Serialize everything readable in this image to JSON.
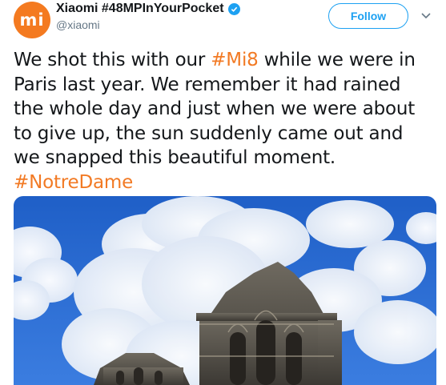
{
  "author": {
    "avatar_text": "mi",
    "display_name": "Xiaomi #48MPInYourPocket",
    "handle": "@xiaomi",
    "verified": true,
    "brand_color": "#f47a20"
  },
  "actions": {
    "follow_label": "Follow",
    "more_icon": "chevron-down-icon"
  },
  "tweet": {
    "line1_pre": "We shot this with our ",
    "line1_tag": "#Mi8",
    "line1_post": " while we were in",
    "line2": "Paris last year. We remember it had rained",
    "line3": "the whole day and just when we were about",
    "line4": "to give up, the sun suddenly came out and",
    "line5": "we snapped this beautiful moment.",
    "line6_tag": "#NotreDame",
    "hashtag_color": "#f27a24"
  },
  "media": {
    "type": "photo"
  }
}
